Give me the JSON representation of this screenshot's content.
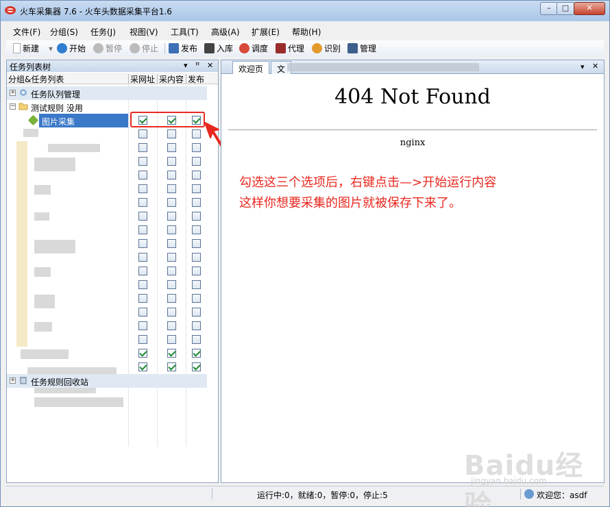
{
  "window": {
    "title": "火车采集器 7.6 - 火车头数据采集平台1.6",
    "min_label": "–",
    "max_label": "□",
    "close_label": "✕"
  },
  "menu": [
    "文件(F)",
    "分组(S)",
    "任务(J)",
    "视图(V)",
    "工具(T)",
    "高级(A)",
    "扩展(E)",
    "帮助(H)"
  ],
  "toolbar": {
    "new": "新建",
    "start": "开始",
    "pause": "暂停",
    "stop": "停止",
    "publish": "发布",
    "import_db": "入库",
    "schedule": "调度",
    "proxy": "代理",
    "recognize": "识别",
    "manage": "管理"
  },
  "task_panel": {
    "title": "任务列表树",
    "pin_icon": "pin-icon",
    "columns": [
      "分组&任务列表",
      "采网址",
      "采内容",
      "发布"
    ],
    "queue_label": "任务队列管理",
    "group_label": "测试规则 没用",
    "selected_task": "图片采集",
    "recycle_label": "任务规则回收站",
    "rows": [
      [
        true,
        true,
        true
      ],
      [
        false,
        false,
        false
      ],
      [
        false,
        false,
        false
      ],
      [
        false,
        false,
        false
      ],
      [
        false,
        false,
        false
      ],
      [
        false,
        false,
        false
      ],
      [
        false,
        false,
        false
      ],
      [
        false,
        false,
        false
      ],
      [
        false,
        false,
        false
      ],
      [
        false,
        false,
        false
      ],
      [
        false,
        false,
        false
      ],
      [
        false,
        false,
        false
      ],
      [
        false,
        false,
        false
      ],
      [
        false,
        false,
        false
      ],
      [
        false,
        false,
        false
      ],
      [
        false,
        false,
        false
      ],
      [
        false,
        false,
        false
      ],
      [
        true,
        true,
        true
      ],
      [
        true,
        true,
        true
      ]
    ]
  },
  "browser": {
    "tab_active": "欢迎页",
    "tab_second": "文",
    "heading": "404 Not Found",
    "server": "nginx"
  },
  "annotation": {
    "line1": "勾选这三个选项后，右键点击—>开始运行内容",
    "line2": "这样你想要采集的图片就被保存下来了。",
    "color": "#e8281f"
  },
  "status": {
    "counts": "运行中:0，就绪:0，暂停:0，停止:5",
    "welcome": "欢迎您：asdf"
  },
  "watermark": {
    "logo": "Baidu经验",
    "url": "jingyan.baidu.com"
  }
}
